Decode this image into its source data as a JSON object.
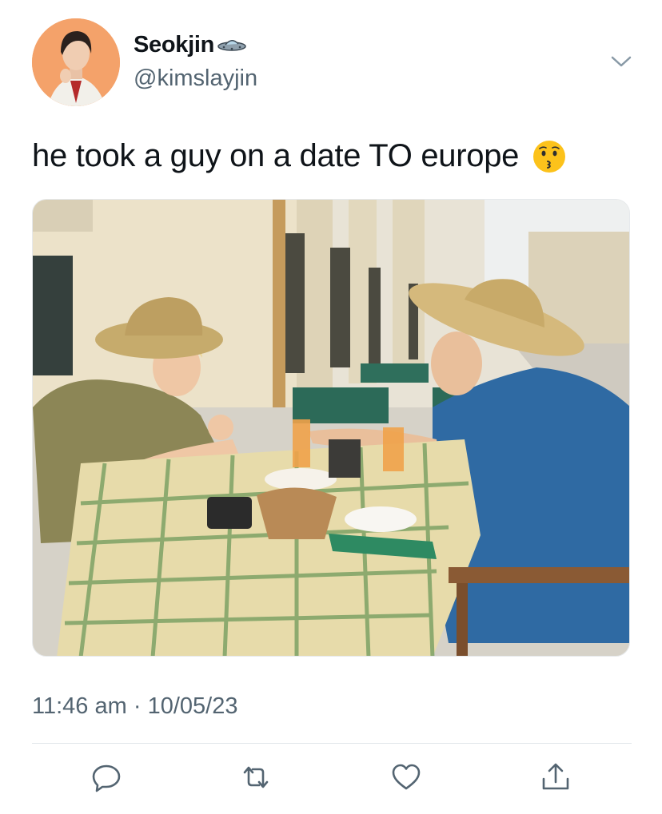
{
  "tweet": {
    "author": {
      "display_name": "Seokjin",
      "handle": "@kimslayjin",
      "name_emoji": "flying-saucer"
    },
    "text": "he took a guy on a date TO europe",
    "text_emoji": "kissing-face",
    "media": {
      "type": "photo",
      "scene": "two men in straw hats eating at an outdoor cafe table with a green checkered tablecloth"
    },
    "time": "11:46 am",
    "separator": "·",
    "date": "10/05/23"
  },
  "actions": [
    {
      "icon": "reply-icon"
    },
    {
      "icon": "retweet-icon"
    },
    {
      "icon": "like-icon"
    },
    {
      "icon": "share-icon"
    }
  ],
  "colors": {
    "text_primary": "#0f1419",
    "text_secondary": "#536471",
    "divider": "#e1e6ea",
    "icon": "#536471"
  }
}
